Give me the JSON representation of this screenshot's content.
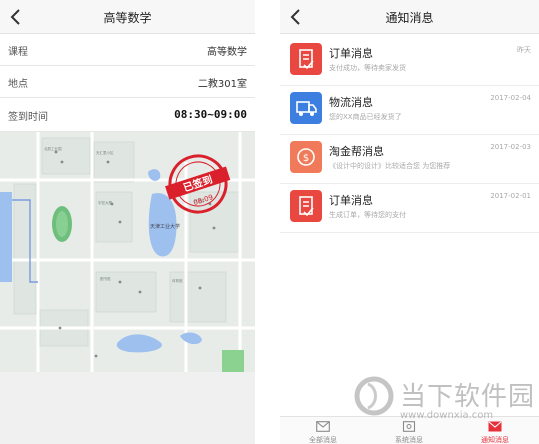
{
  "left_screen": {
    "title": "高等数学",
    "rows": [
      {
        "label": "课程",
        "value": "高等数学"
      },
      {
        "label": "地点",
        "value": "二教301室"
      },
      {
        "label": "签到时间",
        "value": "08:30~09:00"
      }
    ],
    "map": {
      "campus_label": "天津工业大学",
      "stamp_text": "已签到",
      "stamp_time": "08:09",
      "stamp_color": "#d9202b"
    }
  },
  "right_screen": {
    "title": "通知消息",
    "messages": [
      {
        "icon": "order-icon",
        "color": "#e8483f",
        "title": "订单消息",
        "subtitle": "支付成功，等待卖家发货",
        "date": "昨天"
      },
      {
        "icon": "truck-icon",
        "color": "#3d7fe0",
        "title": "物流消息",
        "subtitle": "您的XX商品已经发货了",
        "date": "2017-02-04"
      },
      {
        "icon": "coin-icon",
        "color": "#f07a5a",
        "title": "淘金帮消息",
        "subtitle": "《设计中的设计》比较适合您 为您推荐",
        "date": "2017-02-03"
      },
      {
        "icon": "order-icon",
        "color": "#e8483f",
        "title": "订单消息",
        "subtitle": "生成订单，等待您的支付",
        "date": "2017-02-01"
      }
    ],
    "tabs": [
      {
        "icon": "mail-icon",
        "label": "全部消息",
        "active": false
      },
      {
        "icon": "system-icon",
        "label": "系统消息",
        "active": false
      },
      {
        "icon": "notice-icon",
        "label": "通知消息",
        "active": true
      }
    ]
  },
  "watermark": {
    "brand": "当下软件园",
    "url": "www.downxia.com"
  },
  "colors": {
    "accent": "#e6313a",
    "navbar": "#f7f7f7",
    "divider": "#e6e6e6"
  }
}
